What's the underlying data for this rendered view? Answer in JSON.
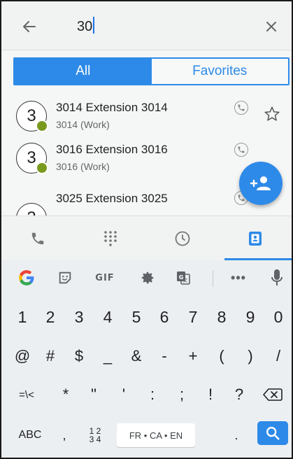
{
  "search": {
    "query": "30",
    "back_icon": "arrow-left-icon",
    "clear_icon": "close-icon"
  },
  "filter_tabs": [
    {
      "label": "All",
      "selected": true
    },
    {
      "label": "Favorites",
      "selected": false
    }
  ],
  "contacts": [
    {
      "avatar_initial": "3",
      "name": "3014 Extension 3014",
      "detail": "3014 (Work)",
      "presence": "available"
    },
    {
      "avatar_initial": "3",
      "name": "3016 Extension 3016",
      "detail": "3016 (Work)",
      "presence": "available"
    },
    {
      "avatar_initial": "3",
      "name": "3025 Extension 3025",
      "detail": "",
      "presence": ""
    }
  ],
  "fab": {
    "icon": "add-contact-icon"
  },
  "nav_tabs": [
    {
      "icon": "phone-icon",
      "selected": false
    },
    {
      "icon": "dialpad-icon",
      "selected": false
    },
    {
      "icon": "clock-icon",
      "selected": false
    },
    {
      "icon": "contacts-icon",
      "selected": true
    }
  ],
  "keyboard": {
    "toolbar": [
      "google-icon",
      "sticker-icon",
      "GIF",
      "settings-icon",
      "translate-icon",
      "•••",
      "microphone-icon"
    ],
    "row_digits": [
      "1",
      "2",
      "3",
      "4",
      "5",
      "6",
      "7",
      "8",
      "9",
      "0"
    ],
    "row_symbols1": [
      "@",
      "#",
      "$",
      "_",
      "&",
      "-",
      "+",
      "(",
      ")",
      "/"
    ],
    "row_symbols2": [
      "=\\<",
      "*",
      "\"",
      "'",
      ":",
      ";",
      "!",
      "?"
    ],
    "abc_label": "ABC",
    "comma": ",",
    "numpad_top": "1 2",
    "numpad_bottom": "3 4",
    "space_label": "FR • CA • EN",
    "period": ".",
    "accent_color": "#2d8ae8"
  }
}
